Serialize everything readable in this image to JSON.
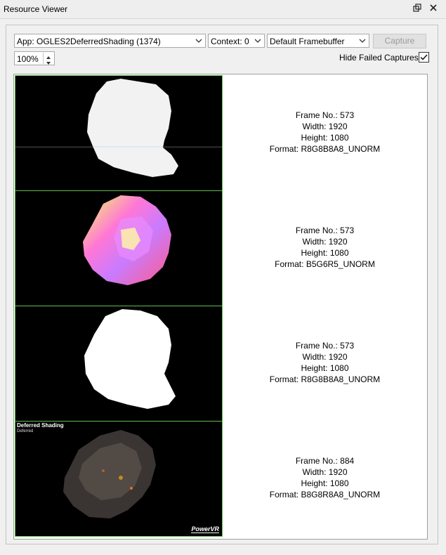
{
  "window": {
    "title": "Resource Viewer"
  },
  "toolbar": {
    "app": "App: OGLES2DeferredShading (1374)",
    "context": "Context: 0",
    "framebuffer": "Default Framebuffer",
    "capture_label": "Capture",
    "zoom": "100%",
    "hide_failed_label": "Hide Failed Captures",
    "hide_failed_checked": true
  },
  "captures": [
    {
      "frame": "Frame No.: 573",
      "width": "Width: 1920",
      "height": "Height: 1080",
      "format": "Format: R8G8B8A8_UNORM"
    },
    {
      "frame": "Frame No.: 573",
      "width": "Width: 1920",
      "height": "Height: 1080",
      "format": "Format: B5G6R5_UNORM"
    },
    {
      "frame": "Frame No.: 573",
      "width": "Width: 1920",
      "height": "Height: 1080",
      "format": "Format: R8G8B8A8_UNORM"
    },
    {
      "frame": "Frame No.: 884",
      "width": "Width: 1920",
      "height": "Height: 1080",
      "format": "Format: B8G8R8A8_UNORM"
    }
  ],
  "thumb_overlay": {
    "title": "Deferred Shading",
    "subtitle": "Deferred",
    "logo": "PowerVR"
  },
  "colors": {
    "accent_border": "#5fbf4e"
  }
}
